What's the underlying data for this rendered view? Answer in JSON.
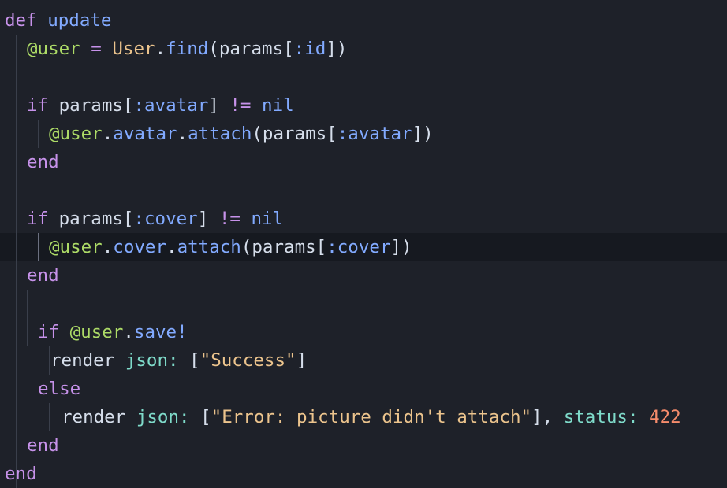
{
  "lines": [
    [
      {
        "t": "def ",
        "c": "kw"
      },
      {
        "t": "update",
        "c": "fn"
      }
    ],
    [
      {
        "t": "@user",
        "c": "ivar"
      },
      {
        "t": " = ",
        "c": "op"
      },
      {
        "t": "User",
        "c": "cls"
      },
      {
        "t": ".",
        "c": "plain"
      },
      {
        "t": "find",
        "c": "fn"
      },
      {
        "t": "(params[",
        "c": "plain"
      },
      {
        "t": ":id",
        "c": "sym"
      },
      {
        "t": "])",
        "c": "plain"
      }
    ],
    [],
    [
      {
        "t": "if ",
        "c": "kw"
      },
      {
        "t": "params[",
        "c": "plain"
      },
      {
        "t": ":avatar",
        "c": "sym"
      },
      {
        "t": "] ",
        "c": "plain"
      },
      {
        "t": "!=",
        "c": "op"
      },
      {
        "t": " ",
        "c": "plain"
      },
      {
        "t": "nil",
        "c": "nil"
      }
    ],
    [
      {
        "t": "@user",
        "c": "ivar"
      },
      {
        "t": ".",
        "c": "plain"
      },
      {
        "t": "avatar",
        "c": "fn"
      },
      {
        "t": ".",
        "c": "plain"
      },
      {
        "t": "attach",
        "c": "fn"
      },
      {
        "t": "(params[",
        "c": "plain"
      },
      {
        "t": ":avatar",
        "c": "sym"
      },
      {
        "t": "])",
        "c": "plain"
      }
    ],
    [
      {
        "t": "end",
        "c": "kw"
      }
    ],
    [],
    [
      {
        "t": "if ",
        "c": "kw"
      },
      {
        "t": "params[",
        "c": "plain"
      },
      {
        "t": ":cover",
        "c": "sym"
      },
      {
        "t": "] ",
        "c": "plain"
      },
      {
        "t": "!=",
        "c": "op"
      },
      {
        "t": " ",
        "c": "plain"
      },
      {
        "t": "nil",
        "c": "nil"
      }
    ],
    [
      {
        "t": "@user",
        "c": "ivar"
      },
      {
        "t": ".",
        "c": "plain"
      },
      {
        "t": "cover",
        "c": "fn"
      },
      {
        "t": ".",
        "c": "plain"
      },
      {
        "t": "attach",
        "c": "fn"
      },
      {
        "t": "(params[",
        "c": "plain"
      },
      {
        "t": ":cover",
        "c": "sym"
      },
      {
        "t": "])",
        "c": "plain"
      }
    ],
    [
      {
        "t": "end",
        "c": "kw"
      }
    ],
    [],
    [
      {
        "t": "if ",
        "c": "kw"
      },
      {
        "t": "@user",
        "c": "ivar"
      },
      {
        "t": ".",
        "c": "plain"
      },
      {
        "t": "save!",
        "c": "fn"
      }
    ],
    [
      {
        "t": "render ",
        "c": "plain"
      },
      {
        "t": "json:",
        "c": "key"
      },
      {
        "t": " [",
        "c": "plain"
      },
      {
        "t": "\"Success\"",
        "c": "str"
      },
      {
        "t": "]",
        "c": "plain"
      }
    ],
    [
      {
        "t": "else",
        "c": "kw"
      }
    ],
    [
      {
        "t": "render ",
        "c": "plain"
      },
      {
        "t": "json:",
        "c": "key"
      },
      {
        "t": " [",
        "c": "plain"
      },
      {
        "t": "\"Error: picture didn't attach\"",
        "c": "str"
      },
      {
        "t": "], ",
        "c": "plain"
      },
      {
        "t": "status:",
        "c": "key"
      },
      {
        "t": " ",
        "c": "plain"
      },
      {
        "t": "422",
        "c": "num"
      }
    ],
    [
      {
        "t": "end",
        "c": "kw"
      }
    ],
    [
      {
        "t": "end",
        "c": "kw"
      }
    ]
  ]
}
